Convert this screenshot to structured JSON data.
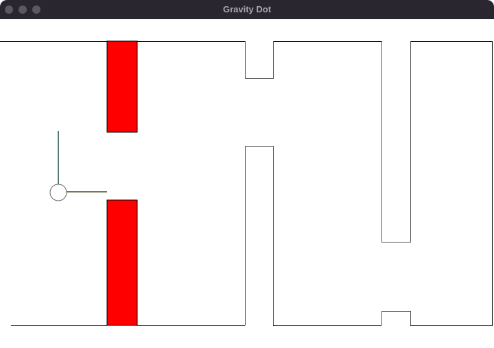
{
  "window": {
    "title": "Gravity Dot",
    "buttons": [
      "close-button",
      "minimize-button",
      "zoom-button"
    ]
  },
  "colors": {
    "titlebar": "#2a2630",
    "hazard": "#ff0000",
    "wall": "#000000",
    "background": "#ffffff",
    "vector_vertical": "#1f4a4a",
    "vector_horizontal": "#4a4a1f"
  },
  "game": {
    "player": "dot",
    "hazards": [
      "upper-red-block",
      "lower-red-block"
    ],
    "icons": [
      "player-dot-icon"
    ]
  }
}
